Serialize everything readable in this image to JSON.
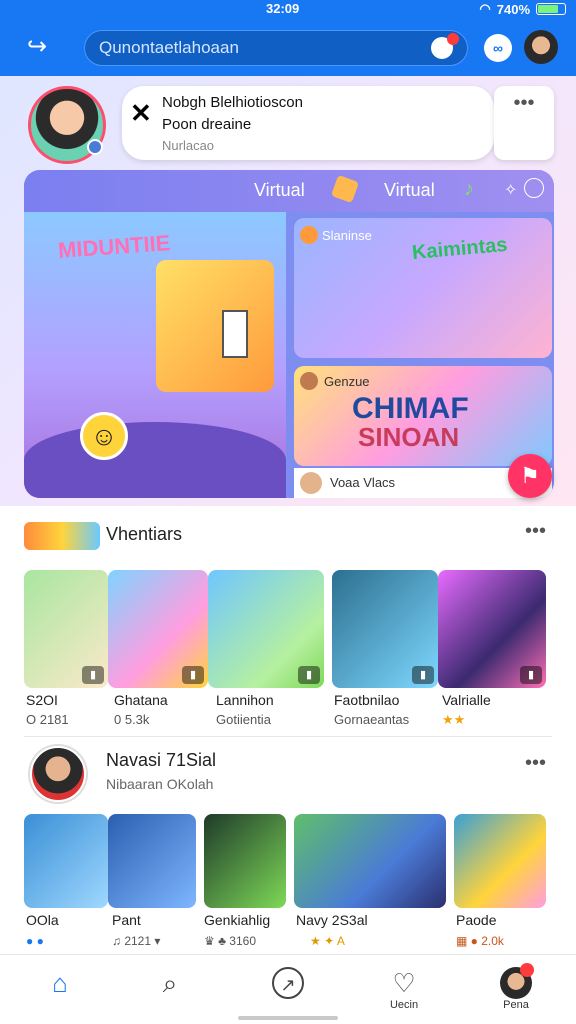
{
  "status": {
    "time": "32:09",
    "battery": "740%",
    "wifi_icon": "wifi-icon"
  },
  "topbar": {
    "search_placeholder": "Qunontaetlahoaan",
    "brand_color": "#1877f2",
    "left_icon": "share-icon",
    "icons": [
      "messenger-icon",
      "profile-avatar"
    ]
  },
  "post": {
    "line1": "Nobgh Blelhiotioscon",
    "line2": "Poon dreaine",
    "line3": "Nurlacao",
    "more": "•••"
  },
  "hero": {
    "label_left": "Virtual",
    "label_right": "Virtual",
    "logo": "MIDUNTIIE",
    "card_a_title": "Slaninse",
    "card_a_logo": "Kaimintas",
    "card_b_title": "Genzue",
    "card_b_logo1": "CHIMAF",
    "card_b_logo2": "SINOAN",
    "card_b_caption": "Voaa Vlacs",
    "fab_icon": "flag-icon"
  },
  "section1": {
    "title": "Vhentiars",
    "more": "•••",
    "tiles": [
      {
        "label": "S2OI",
        "sub": "O 2181"
      },
      {
        "label": "Ghatana",
        "sub": "0 5.3k"
      },
      {
        "label": "Lannihon",
        "sub": "Gotiientia"
      },
      {
        "label": "Faotbnilao",
        "sub": "Gornaeantas"
      },
      {
        "label": "Valrialle",
        "sub": "★★"
      }
    ]
  },
  "section2": {
    "name": "Navasi 71Sial",
    "sub": "Nibaaran OKolah",
    "more": "•••",
    "tiles": [
      {
        "label": "OOla",
        "sub": "● ●"
      },
      {
        "label": "Pant",
        "sub": "♫ 2121 ▾"
      },
      {
        "label": "Genkiahlig",
        "sub": "♛ ♣ 3160"
      },
      {
        "label": "Navy 2S3al",
        "sub": "★ ✦ A"
      },
      {
        "label": "Paode",
        "sub": "▦ ● 2.0k"
      }
    ]
  },
  "nav": {
    "items": [
      {
        "icon": "home-icon",
        "label": ""
      },
      {
        "icon": "search-icon",
        "label": ""
      },
      {
        "icon": "compass-icon",
        "label": ""
      },
      {
        "icon": "heart-chat-icon",
        "label": "Uecin"
      },
      {
        "icon": "profile-icon",
        "label": "Pena"
      }
    ]
  }
}
